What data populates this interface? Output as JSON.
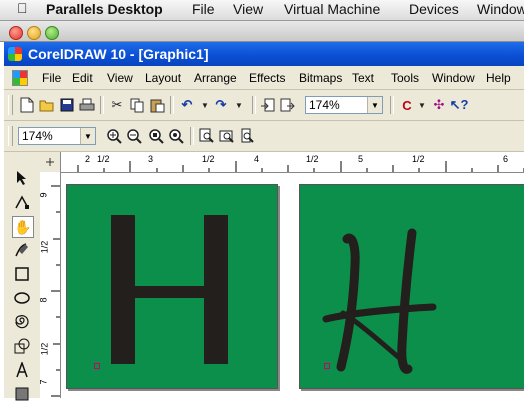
{
  "mac_menubar": {
    "items": [
      "Parallels Desktop",
      "File",
      "View",
      "Virtual Machine",
      "Devices",
      "Window"
    ]
  },
  "window": {
    "title": "CorelDRAW 10 - [Graphic1]"
  },
  "menubar": {
    "items": [
      "File",
      "Edit",
      "View",
      "Layout",
      "Arrange",
      "Effects",
      "Bitmaps",
      "Text",
      "Tools",
      "Window",
      "Help"
    ]
  },
  "toolbar": {
    "zoom_level": "174%"
  },
  "zoom_toolbar": {
    "zoom_level": "174%"
  },
  "ruler_h": [
    "2",
    "1/2",
    "3",
    "1/2",
    "4",
    "1/2",
    "5",
    "1/2",
    "6"
  ],
  "ruler_v": [
    "9",
    "1/2",
    "8",
    "1/2",
    "7"
  ],
  "canvas": {
    "page_color": "#0d8f4c",
    "glyph_color": "#231f1c",
    "left_letter": "H",
    "right_letter": "H"
  }
}
